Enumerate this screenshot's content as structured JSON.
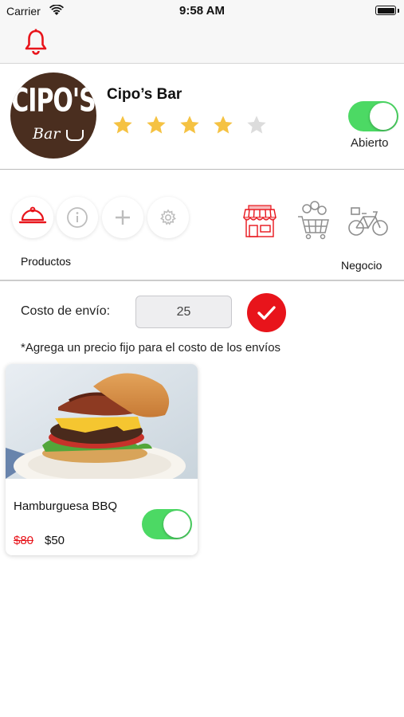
{
  "status_bar": {
    "carrier": "Carrier",
    "time": "9:58 AM"
  },
  "navbar": {
    "icon": "bell-icon",
    "accent_color": "#e8141b"
  },
  "restaurant": {
    "logo_text": "CIPO'S",
    "logo_script": "Bar",
    "name": "Cipo’s Bar",
    "rating": 4,
    "max_rating": 5,
    "open_toggle_on": true,
    "open_label": "Abierto"
  },
  "menu": {
    "left_icons": [
      "cloche-icon",
      "info-icon",
      "plus-icon",
      "gear-icon"
    ],
    "right_icons": [
      "store-icon",
      "cart-icon",
      "bicycle-icon"
    ],
    "left_label": "Productos",
    "right_label": "Negocio"
  },
  "shipping": {
    "label": "Costo de envío:",
    "value": "25",
    "note": "*Agrega un precio fijo para el costo de los envíos"
  },
  "products": [
    {
      "name": "Hamburguesa BBQ",
      "old_price": "$80",
      "price": "$50",
      "enabled": true
    }
  ],
  "colors": {
    "accent": "#e8141b",
    "toggle_on": "#4cd964",
    "star": "#f5c242",
    "star_off": "#dcdcdc"
  }
}
